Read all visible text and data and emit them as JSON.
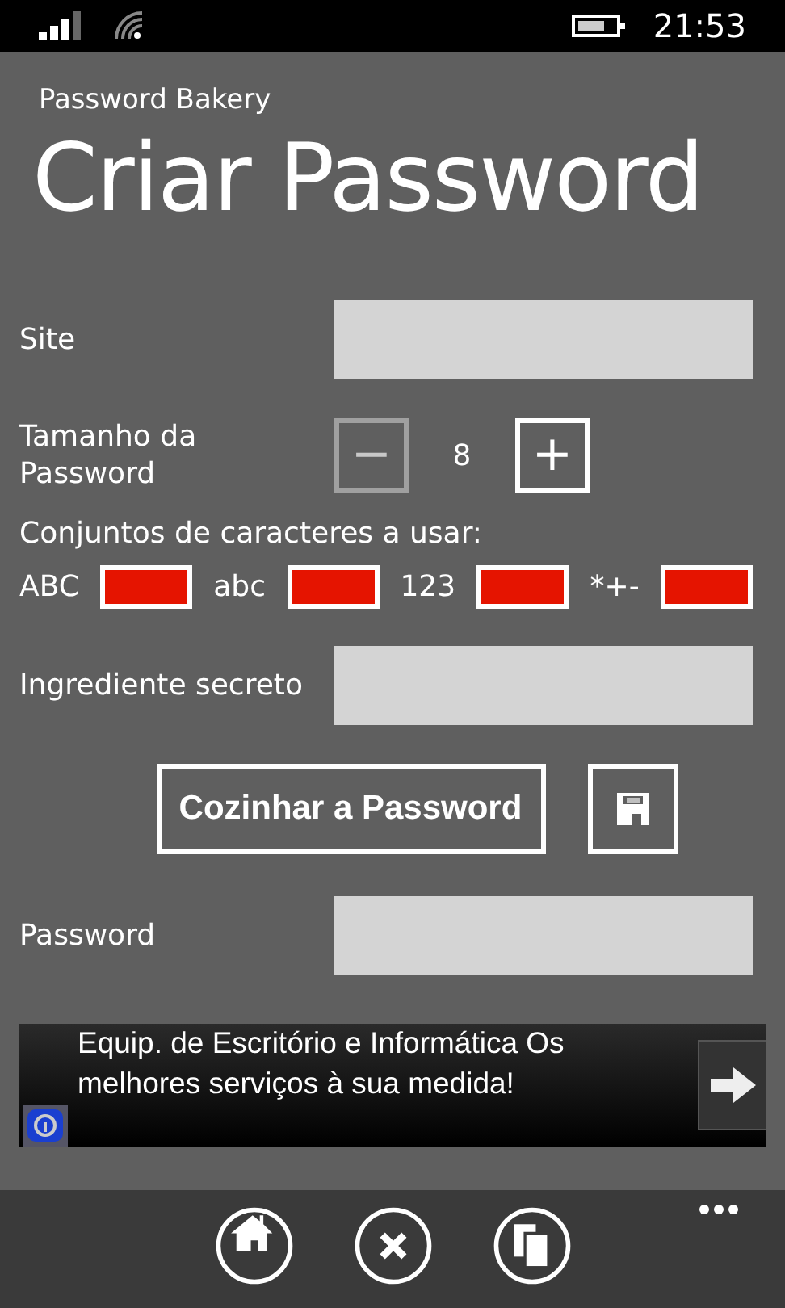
{
  "status_bar": {
    "time": "21:53"
  },
  "app_title": "Password Bakery",
  "page_title": "Criar Password",
  "site": {
    "label": "Site"
  },
  "length": {
    "label": "Tamanho da Password",
    "value": "8",
    "minus": {
      "symbol": "−",
      "disabled": true
    },
    "plus": {
      "symbol": "+",
      "disabled": false
    }
  },
  "charsets": {
    "label": "Conjuntos de caracteres a usar:",
    "items": [
      {
        "label": "ABC",
        "checked": true
      },
      {
        "label": "abc",
        "checked": true
      },
      {
        "label": "123",
        "checked": true
      },
      {
        "label": "*+-",
        "checked": true
      }
    ]
  },
  "secret": {
    "label": "Ingrediente secreto"
  },
  "bake_button": "Cozinhar a Password",
  "password": {
    "label": "Password"
  },
  "ad": {
    "text": "Equip. de Escritório e Informática Os melhores serviços à sua medida!"
  },
  "app_bar": {
    "buttons": [
      {
        "kind": "home"
      },
      {
        "kind": "close"
      },
      {
        "kind": "copy"
      }
    ]
  }
}
